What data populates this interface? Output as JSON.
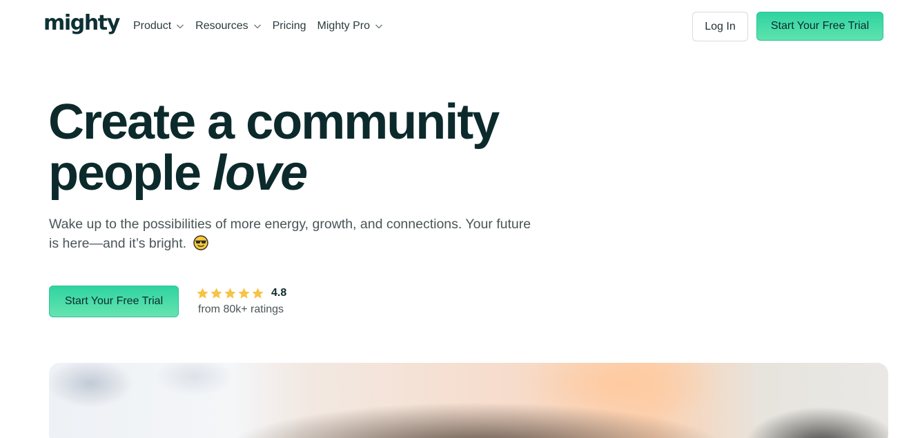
{
  "nav": {
    "logo": "mighty",
    "links": [
      {
        "label": "Product",
        "dropdown": true
      },
      {
        "label": "Resources",
        "dropdown": true
      },
      {
        "label": "Pricing",
        "dropdown": false
      },
      {
        "label": "Mighty Pro",
        "dropdown": true
      }
    ],
    "login_label": "Log In",
    "trial_label": "Start Your Free Trial"
  },
  "hero": {
    "title_line1": "Create a community",
    "title_line2_plain": "people ",
    "title_line2_italic": "love",
    "subtitle": "Wake up to the possibilities of more energy, growth, and connections. Your future is here—and it’s bright.",
    "emoji_icon": "smiling-face-with-sunglasses-icon",
    "cta_label": "Start Your Free Trial"
  },
  "rating": {
    "value": "4.8",
    "stars": 5,
    "label": "from 80k+ ratings"
  },
  "colors": {
    "brand_dark": "#0c2a2b",
    "accent_green": "#2fd3a0",
    "star": "#f6c344"
  }
}
